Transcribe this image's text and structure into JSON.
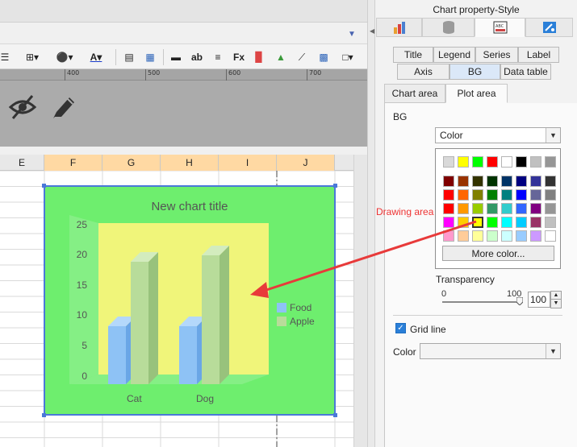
{
  "panel": {
    "title": "Chart property-Style",
    "type_tabs": [
      "Title",
      "Legend",
      "Series",
      "Label",
      "Axis",
      "BG",
      "Data table"
    ],
    "area_tabs": [
      "Chart area",
      "Plot area"
    ],
    "bg_label": "BG",
    "bg_select_value": "Color",
    "more_color": "More color...",
    "transparency_label": "Transparency",
    "slider_min": "0",
    "slider_max": "100",
    "transparency_value": "100",
    "transparency_level": 1.0,
    "grid_line_label": "Grid line",
    "grid_line_checked": true,
    "color_label": "Color",
    "color_value": ""
  },
  "annotation": {
    "text": "Drawing area",
    "color": "#e83a3a"
  },
  "palette": {
    "top_row": [
      "#d9d9d9",
      "#ffff00",
      "#00ff00",
      "#ff0000",
      "#ffffff",
      "#000000",
      "#c0c0c0",
      "#969696"
    ],
    "grid": [
      [
        "#800000",
        "#993300",
        "#333300",
        "#003300",
        "#003366",
        "#000080",
        "#333399",
        "#333333"
      ],
      [
        "#ff0000",
        "#ff6600",
        "#808000",
        "#008000",
        "#008080",
        "#0000ff",
        "#666699",
        "#808080"
      ],
      [
        "#ff0000",
        "#ff9900",
        "#99cc00",
        "#339966",
        "#33cccc",
        "#3366ff",
        "#800080",
        "#969696"
      ],
      [
        "#ff00ff",
        "#ffcc00",
        "#ffff00",
        "#00ff00",
        "#00ffff",
        "#00ccff",
        "#993366",
        "#c0c0c0"
      ],
      [
        "#ff99cc",
        "#ffcc99",
        "#ffff99",
        "#ccffcc",
        "#ccffff",
        "#99ccff",
        "#cc99ff",
        "#ffffff"
      ]
    ]
  },
  "ruler": {
    "ticks": [
      "400",
      "500",
      "600",
      "700"
    ]
  },
  "sheet": {
    "columns": [
      "E",
      "F",
      "G",
      "H",
      "I",
      "J"
    ]
  },
  "chart_data": {
    "type": "bar",
    "title": "New chart title",
    "categories": [
      "Cat",
      "Dog"
    ],
    "series": [
      {
        "name": "Food",
        "values": [
          9,
          9
        ],
        "color": "#8ec2f5"
      },
      {
        "name": "Apple",
        "values": [
          19,
          20
        ],
        "color": "#b8dc9a"
      }
    ],
    "y_ticks": [
      "25",
      "20",
      "15",
      "10",
      "5",
      "0"
    ],
    "ylim": [
      0,
      25
    ],
    "legend_position": "right",
    "chart_area_color": "#6eee6e",
    "plot_area_color": "#f0f57a"
  }
}
